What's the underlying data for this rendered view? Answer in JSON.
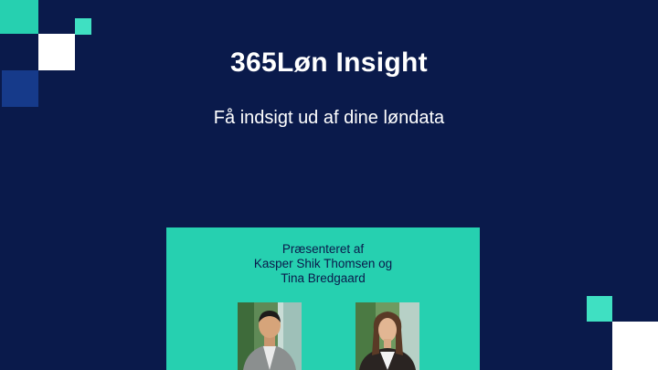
{
  "slide": {
    "title": "365Løn Insight",
    "subtitle": "Få indsigt ud af dine løndata"
  },
  "panel": {
    "lines": [
      "Præsenteret af",
      "Kasper Shik Thomsen og",
      "Tina Bredgaard"
    ]
  },
  "photos": [
    {
      "name": "portrait-photo-kasper",
      "description_icon": "person-photo"
    },
    {
      "name": "portrait-photo-tina",
      "description_icon": "person-photo"
    }
  ],
  "colors": {
    "background": "#0a1a4b",
    "teal": "#26d0b0",
    "teal_light": "#3fe0c2",
    "white": "#ffffff",
    "blue": "#163a8a"
  }
}
